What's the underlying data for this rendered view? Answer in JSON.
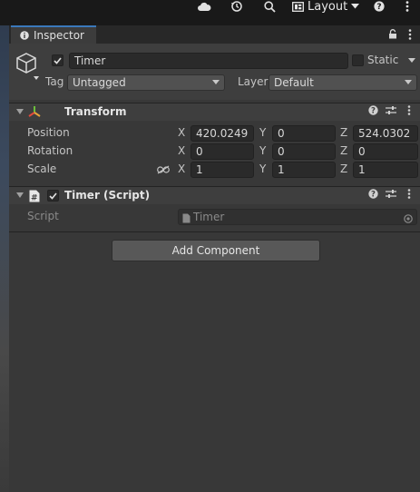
{
  "topbar": {
    "layout_label": "Layout"
  },
  "tab": {
    "title": "Inspector"
  },
  "header": {
    "object_name": "Timer",
    "static_label": "Static",
    "tag_label": "Tag",
    "tag_value": "Untagged",
    "layer_label": "Layer",
    "layer_value": "Default"
  },
  "transform": {
    "title": "Transform",
    "rows": [
      {
        "label": "Position",
        "x": "420.0249",
        "y": "0",
        "z": "524.0302"
      },
      {
        "label": "Rotation",
        "x": "0",
        "y": "0",
        "z": "0"
      },
      {
        "label": "Scale",
        "x": "1",
        "y": "1",
        "z": "1"
      }
    ],
    "axes": {
      "x": "X",
      "y": "Y",
      "z": "Z"
    }
  },
  "script_component": {
    "title": "Timer (Script)",
    "field_label": "Script",
    "field_value": "Timer"
  },
  "add_component_label": "Add Component",
  "colors": {
    "tab_accent": "#3a79bb",
    "panel_bg": "#383838",
    "field_bg": "#2a2a2a"
  }
}
